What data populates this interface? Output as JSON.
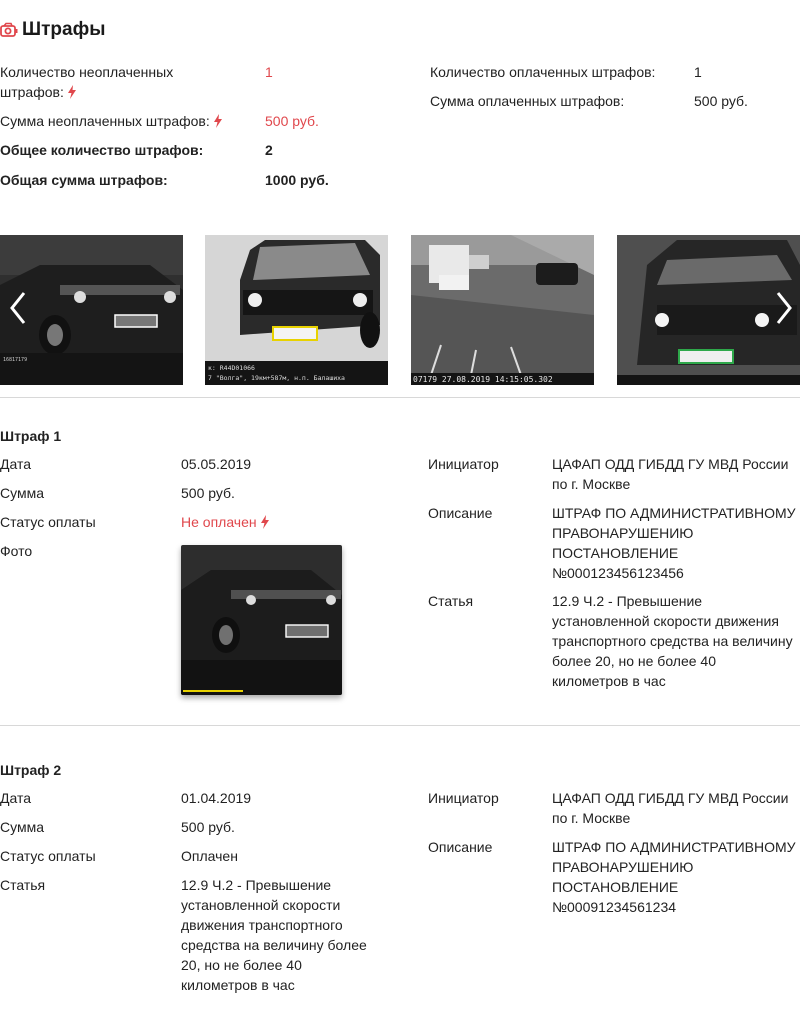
{
  "page": {
    "title": "Штрафы",
    "title_icon": "camera-icon",
    "accent_color": "#e0474c"
  },
  "summary": {
    "unpaid_count_label_1": "Количество неоплаченных",
    "unpaid_count_label_2": "штрафов:",
    "unpaid_count_value": "1",
    "unpaid_sum_label": "Сумма неоплаченных штрафов:",
    "unpaid_sum_value": "500 руб.",
    "total_count_label": "Общее количество штрафов:",
    "total_count_value": "2",
    "total_sum_label": "Общая сумма штрафов:",
    "total_sum_value": "1000 руб.",
    "paid_count_label": "Количество оплаченных штрафов:",
    "paid_count_value": "1",
    "paid_sum_label": "Сумма оплаченных штрафов:",
    "paid_sum_value": "500 руб."
  },
  "gallery": {
    "captions": [
      "16817179",
      "к: R44D01066",
      "07179 27.08.2019 14:15:05.302",
      ""
    ],
    "sub_captions": [
      "",
      "7 \"Волга\", 19км+587м, н.п. Балашиха",
      "",
      ""
    ],
    "prev_icon": "chevron-left-icon",
    "next_icon": "chevron-right-icon"
  },
  "fines": [
    {
      "heading": "Штраф 1",
      "date_label": "Дата",
      "date_value": "05.05.2019",
      "sum_label": "Сумма",
      "sum_value": "500 руб.",
      "status_label": "Статус оплаты",
      "status_value": "Не оплачен",
      "photo_label": "Фото",
      "initiator_label": "Инициатор",
      "initiator_value_1": "ЦАФАП ОДД ГИБДД ГУ МВД России",
      "initiator_value_2": "по г. Москве",
      "description_label": "Описание",
      "description_lines": [
        "ШТРАФ ПО АДМИНИСТРАТИВНОМУ",
        "ПРАВОНАРУШЕНИЮ",
        "ПОСТАНОВЛЕНИЕ",
        "№000123456123456"
      ],
      "article_label": "Статья",
      "article_lines": [
        "12.9 Ч.2 - Превышение",
        "установленной скорости движения",
        "транспортного средства на величину",
        "более 20, но не более 40",
        "километров в час"
      ]
    },
    {
      "heading": "Штраф 2",
      "date_label": "Дата",
      "date_value": "01.04.2019",
      "sum_label": "Сумма",
      "sum_value": "500 руб.",
      "status_label": "Статус оплаты",
      "status_value": "Оплачен",
      "article_label": "Статья",
      "article_lines": [
        "12.9 Ч.2 - Превышение",
        "установленной скорости",
        "движения транспортного",
        "средства на величину более",
        "20, но не более 40",
        "километров в час"
      ],
      "initiator_label": "Инициатор",
      "initiator_value_1": "ЦАФАП ОДД ГИБДД ГУ МВД России",
      "initiator_value_2": "по г. Москве",
      "description_label": "Описание",
      "description_lines": [
        "ШТРАФ ПО АДМИНИСТРАТИВНОМУ",
        "ПРАВОНАРУШЕНИЮ",
        "ПОСТАНОВЛЕНИЕ",
        "№00091234561234"
      ]
    }
  ]
}
